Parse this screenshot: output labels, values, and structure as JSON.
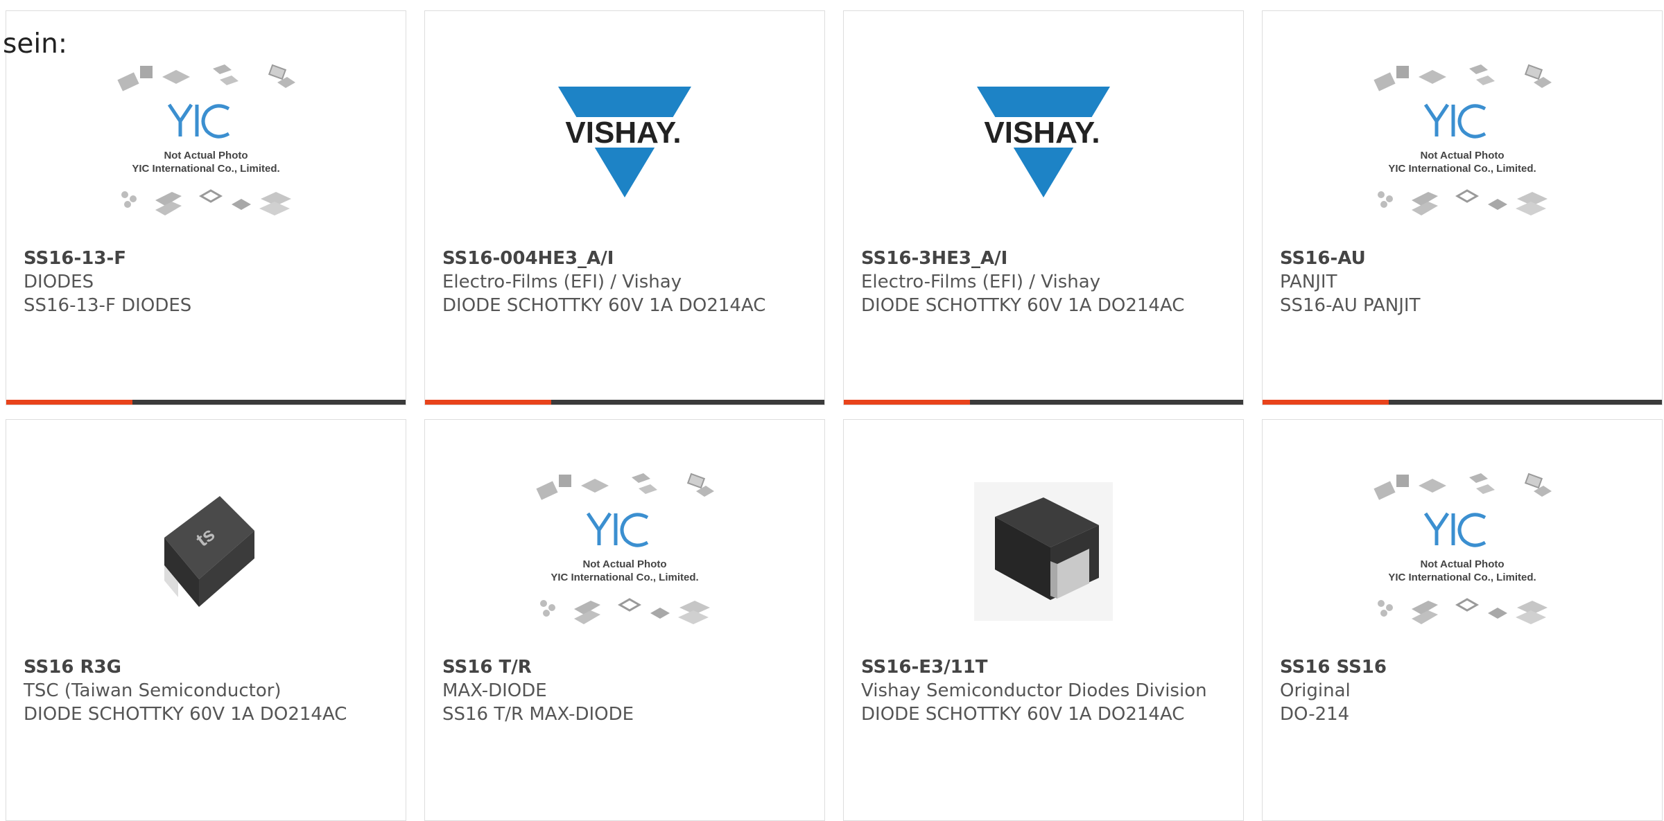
{
  "intro_text": "sein:",
  "colors": {
    "accent_bar": "#e8431b",
    "dark_bar": "#3b3b3b",
    "vishay_blue": "#1d83c6",
    "yic_blue": "#3b8fd0"
  },
  "placeholder_logo": {
    "caption_line1": "Not Actual Photo",
    "caption_line2": "YIC International Co., Limited.",
    "brand": "YIC"
  },
  "vishay_logo_text": "VISHAY.",
  "products": [
    {
      "part_number": "SS16-13-F",
      "manufacturer": "DIODES",
      "description": "SS16-13-F DIODES",
      "image": "yic-placeholder"
    },
    {
      "part_number": "SS16-004HE3_A/I",
      "manufacturer": "Electro-Films (EFI) / Vishay",
      "description": "DIODE SCHOTTKY 60V 1A DO214AC",
      "image": "vishay-logo"
    },
    {
      "part_number": "SS16-3HE3_A/I",
      "manufacturer": "Electro-Films (EFI) / Vishay",
      "description": "DIODE SCHOTTKY 60V 1A DO214AC",
      "image": "vishay-logo"
    },
    {
      "part_number": "SS16-AU",
      "manufacturer": "PANJIT",
      "description": "SS16-AU PANJIT",
      "image": "yic-placeholder"
    },
    {
      "part_number": "SS16 R3G",
      "manufacturer": "TSC (Taiwan Semiconductor)",
      "description": "DIODE SCHOTTKY 60V 1A DO214AC",
      "image": "tsc-package"
    },
    {
      "part_number": "SS16 T/R",
      "manufacturer": "MAX-DIODE",
      "description": "SS16 T/R MAX-DIODE",
      "image": "yic-placeholder"
    },
    {
      "part_number": "SS16-E3/11T",
      "manufacturer": "Vishay Semiconductor Diodes Division",
      "description": "DIODE SCHOTTKY 60V 1A DO214AC",
      "image": "smd-package"
    },
    {
      "part_number": "SS16 SS16",
      "manufacturer": "Original",
      "description": "DO-214",
      "image": "yic-placeholder"
    }
  ]
}
